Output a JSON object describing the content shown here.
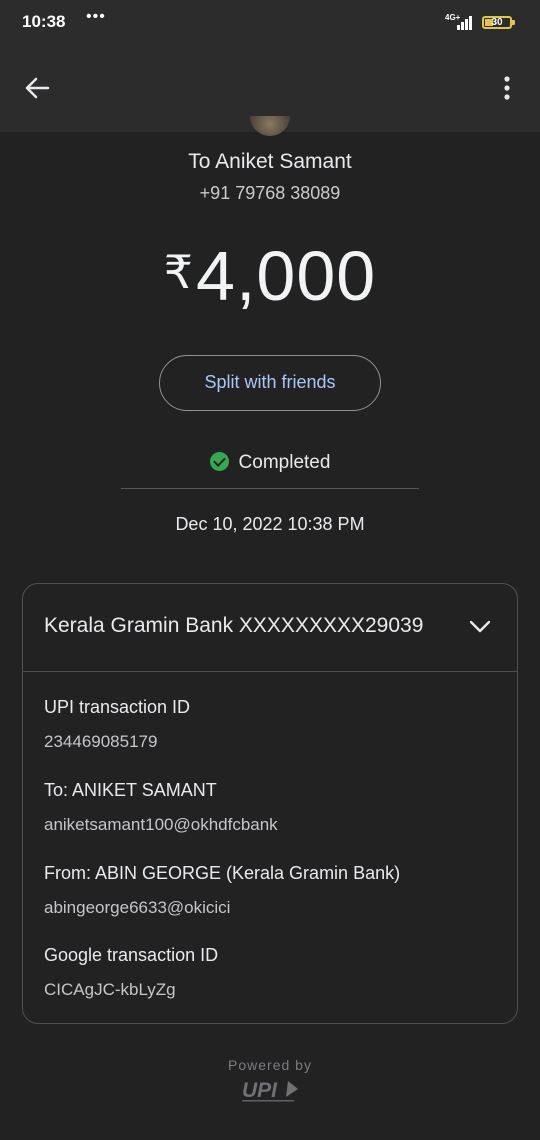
{
  "status_bar": {
    "time": "10:38",
    "dots": "•••",
    "network": "4G+",
    "battery": "30"
  },
  "header": {
    "back_icon": "back-arrow-icon",
    "more_icon": "more-vert-icon"
  },
  "recipient": {
    "name": "To Aniket Samant",
    "phone": "+91 79768 38089"
  },
  "payment": {
    "currency": "₹",
    "amount": "4,000"
  },
  "actions": {
    "split_label": "Split with friends"
  },
  "status": {
    "label": "Completed",
    "color": "#34a853"
  },
  "datetime": "Dec 10, 2022 10:38 PM",
  "details": {
    "bank": "Kerala Gramin Bank XXXXXXXXX29039",
    "rows": [
      {
        "label": "UPI transaction ID",
        "value": "234469085179"
      },
      {
        "label": "To: ANIKET SAMANT",
        "value": "aniketsamant100@okhdfcbank"
      },
      {
        "label": "From: ABIN GEORGE (Kerala Gramin Bank)",
        "value": "abingeorge6633@okicici"
      },
      {
        "label": "Google transaction ID",
        "value": "CICAgJC-kbLyZg"
      }
    ]
  },
  "footer": {
    "powered_by": "Powered by",
    "logo_text": "UPI"
  },
  "colors": {
    "background": "#222223",
    "accent": "#a8c7fa"
  }
}
